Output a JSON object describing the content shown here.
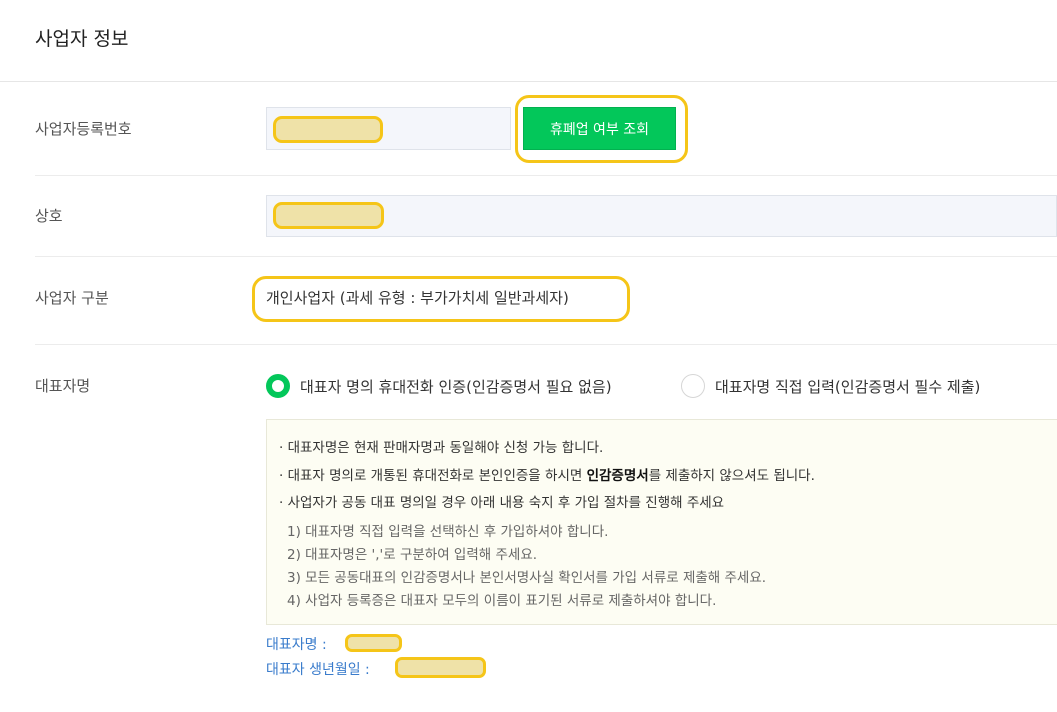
{
  "page": {
    "title": "사업자 정보"
  },
  "business_number": {
    "label": "사업자등록번호",
    "button_label": "휴폐업 여부 조회"
  },
  "company_name": {
    "label": "상호"
  },
  "business_type": {
    "label": "사업자 구분",
    "value": "개인사업자 (과세 유형 : 부가가치세 일반과세자)"
  },
  "representative": {
    "label": "대표자명",
    "options": [
      {
        "label": "대표자 명의 휴대전화 인증(인감증명서 필요 없음)",
        "selected": true
      },
      {
        "label": "대표자명 직접 입력(인감증명서 필수 제출)",
        "selected": false
      }
    ],
    "notice": {
      "line1": "· 대표자명은 현재 판매자명과 동일해야 신청 가능 합니다.",
      "line2_pre": "· 대표자 명의로 개통된 휴대전화로 본인인증을 하시면 ",
      "line2_bold": "인감증명서",
      "line2_post": "를 제출하지 않으셔도 됩니다.",
      "line3": "· 사업자가 공동 대표 명의일 경우 아래 내용 숙지 후 가입 절차를 진행해 주세요",
      "sub1": "1) 대표자명 직접 입력을 선택하신 후 가입하셔야 합니다.",
      "sub2": "2) 대표자명은 ','로 구분하여 입력해 주세요.",
      "sub3": "3) 모든 공동대표의 인감증명서나 본인서명사실 확인서를 가입 서류로 제출해 주세요.",
      "sub4": "4) 사업자 등록증은 대표자 모두의 이름이 표기된 서류로 제출하셔야 합니다."
    },
    "name_info_label": "대표자명 :",
    "birth_info_label": "대표자 생년월일 :"
  },
  "colors": {
    "accent_green": "#03c75a",
    "highlight_yellow": "#f5c518",
    "link_blue": "#3a7ccc"
  }
}
